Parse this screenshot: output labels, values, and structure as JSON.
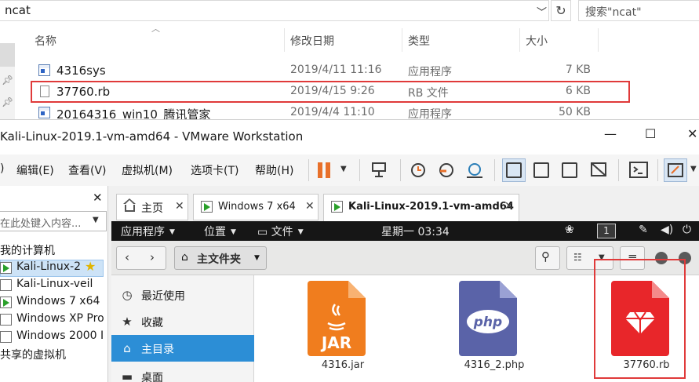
{
  "explorer": {
    "address": "ncat",
    "search_placeholder": "搜索\"ncat\"",
    "columns": {
      "name": "名称",
      "date": "修改日期",
      "type": "类型",
      "size": "大小"
    },
    "files": [
      {
        "name": "4316sys",
        "date": "2019/4/11 11:16",
        "type": "应用程序",
        "size": "7 KB",
        "icon": "exe-icon"
      },
      {
        "name": "37760.rb",
        "date": "2019/4/15 9:26",
        "type": "RB 文件",
        "size": "6 KB",
        "icon": "file-icon"
      },
      {
        "name": "20164316_win10_腾讯管家",
        "date": "2019/4/4 11:10",
        "type": "应用程序",
        "size": "50 KB",
        "icon": "exe-icon"
      }
    ],
    "highlight_color": "#e03a3a"
  },
  "vmware": {
    "title": "Kali-Linux-2019.1-vm-amd64 - VMware Workstation",
    "window_controls": {
      "minimize": "—",
      "maximize": "☐",
      "close": "✕"
    },
    "menu": [
      "编辑(E)",
      "查看(V)",
      "虚拟机(M)",
      "选项卡(T)",
      "帮助(H)"
    ],
    "menu_prefix": ")",
    "library": {
      "close": "✕",
      "search_placeholder": "在此处键入内容...",
      "my_computer": "我的计算机",
      "vms": [
        {
          "name": "Kali-Linux-2",
          "running": true,
          "favorite": true,
          "selected": true
        },
        {
          "name": "Kali-Linux-veil",
          "running": false
        },
        {
          "name": "Windows 7 x64",
          "running": true
        },
        {
          "name": "Windows XP Pro",
          "running": false
        },
        {
          "name": "Windows 2000 I",
          "running": false
        }
      ],
      "shared": "共享的虚拟机"
    },
    "tabs": [
      {
        "label": "主页",
        "icon": "home-icon"
      },
      {
        "label": "Windows 7 x64",
        "icon": "vm-icon"
      },
      {
        "label": "Kali-Linux-2019.1-vm-amd64",
        "icon": "vm-icon",
        "active": true
      }
    ],
    "tab_close": "✕",
    "accent": "#e8702a"
  },
  "guest": {
    "topbar": {
      "apps": "应用程序",
      "places": "位置",
      "files": "文件",
      "clock": "星期一 03:34",
      "workspace": "1"
    },
    "filemanager": {
      "path_label": "主文件夹",
      "sidebar": [
        {
          "label": "最近使用",
          "icon": "clock-icon"
        },
        {
          "label": "收藏",
          "icon": "star-icon"
        },
        {
          "label": "主目录",
          "icon": "home-icon",
          "active": true
        },
        {
          "label": "桌面",
          "icon": "desktop-icon"
        }
      ],
      "files": [
        {
          "label": "4316.jar",
          "badge": "JAR",
          "color": "#f07d1e"
        },
        {
          "label": "4316_2.php",
          "badge": "php",
          "color": "#5a63a8"
        },
        {
          "label": "37760.rb",
          "badge": "",
          "color": "#e8262a"
        }
      ],
      "selected_accent": "#2c8ed6"
    }
  }
}
